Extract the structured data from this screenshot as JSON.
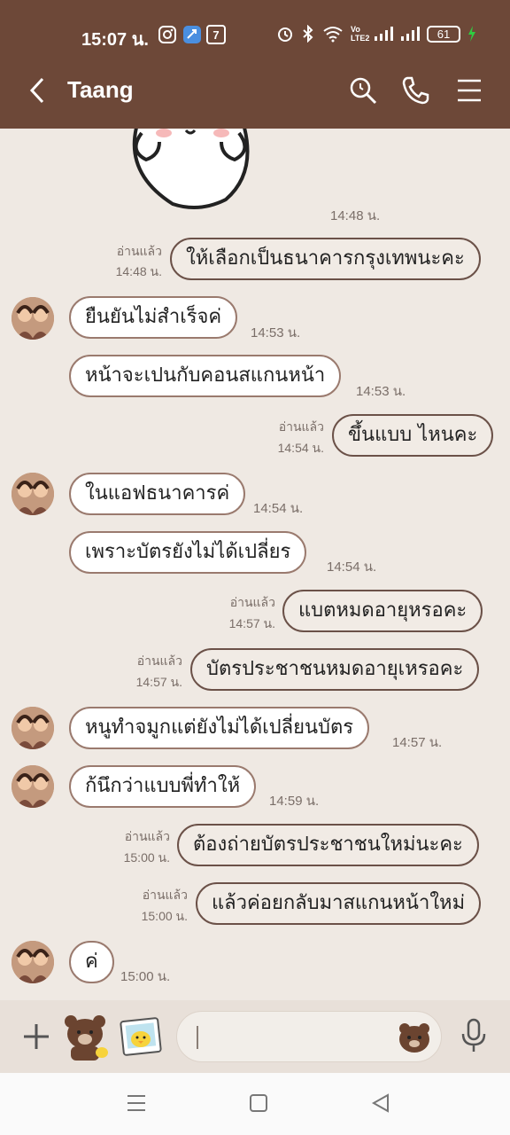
{
  "status_bar": {
    "time": "15:07 น.",
    "battery": "61",
    "network_label": "Vo LTE2"
  },
  "header": {
    "title": "Taang",
    "back_icon": "chevron-left-icon",
    "search_icon": "search-icon",
    "call_icon": "phone-icon",
    "menu_icon": "hamburger-menu-icon"
  },
  "messages": [
    {
      "type": "sticker",
      "time": "14:48 น."
    },
    {
      "type": "out",
      "text": "ให้เลือกเป็นธนาคารกรุงเทพนะคะ",
      "read": "อ่านแล้ว",
      "time": "14:48 น."
    },
    {
      "type": "in",
      "text": "ยืนยันไม่สำเร็จค่",
      "time": "14:53 น."
    },
    {
      "type": "in",
      "text": "หน้าจะเปนกับคอนสแกนหน้า",
      "time": "14:53 น."
    },
    {
      "type": "out",
      "text": "ขึ้นแบบ ไหนคะ",
      "read": "อ่านแล้ว",
      "time": "14:54 น."
    },
    {
      "type": "in",
      "text": "ในแอฟธนาคารค่",
      "time": "14:54 น."
    },
    {
      "type": "in",
      "text": "เพราะบัตรยังไม่ได้เปลี่ยร",
      "time": "14:54 น."
    },
    {
      "type": "out",
      "text": "แบตหมดอายุหรอคะ",
      "read": "อ่านแล้ว",
      "time": "14:57 น."
    },
    {
      "type": "out",
      "text": "บัตรประชาชนหมดอายุเหรอคะ",
      "read": "อ่านแล้ว",
      "time": "14:57 น."
    },
    {
      "type": "in",
      "text": "หนูทำจมูกแต่ยังไม่ได้เปลี่ยนบัตร",
      "time": "14:57 น."
    },
    {
      "type": "in",
      "text": "ก้นึกว่าแบบพี่ทำให้",
      "time": "14:59 น."
    },
    {
      "type": "out",
      "text": "ต้องถ่ายบัตรประชาชนใหม่นะคะ",
      "read": "อ่านแล้ว",
      "time": "15:00 น."
    },
    {
      "type": "out",
      "text": "แล้วค่อยกลับมาสแกนหน้าใหม่",
      "read": "อ่านแล้ว",
      "time": "15:00 น."
    },
    {
      "type": "in",
      "text": "ค่",
      "time": "15:00 น."
    }
  ],
  "input": {
    "placeholder": "",
    "add_icon": "plus-icon",
    "sticker_icon": "brown-bear-sticker-icon",
    "photo_icon": "photo-sticker-icon",
    "emoji_icon": "bear-face-icon",
    "mic_icon": "microphone-icon"
  },
  "navbar": {
    "menu_icon": "recent-apps-icon",
    "home_icon": "home-square-icon",
    "back_icon": "back-triangle-icon"
  },
  "colors": {
    "header_bg": "#6d4838",
    "chat_bg": "#efe9e3",
    "bubble_in_border": "#9a7a6e",
    "bubble_out_border": "#6b5148"
  }
}
